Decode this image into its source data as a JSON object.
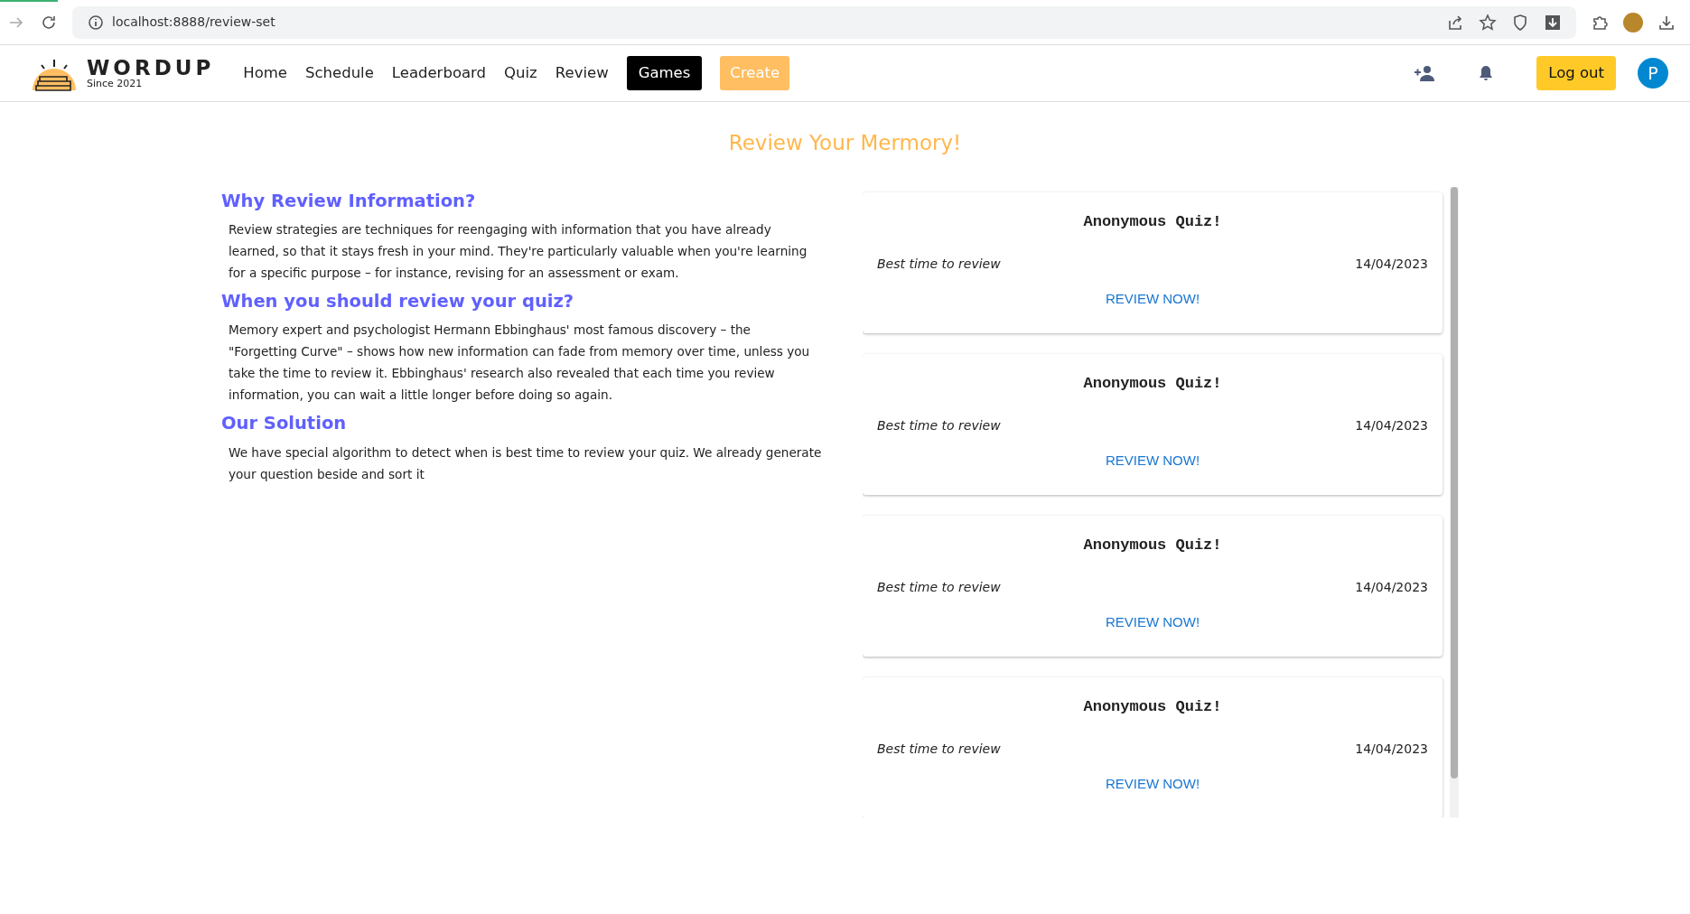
{
  "browser": {
    "url": "localhost:8888/review-set"
  },
  "brand": {
    "name": "WORDUP",
    "tagline": "Since 2021"
  },
  "nav": [
    {
      "label": "Home",
      "kind": "link"
    },
    {
      "label": "Schedule",
      "kind": "link"
    },
    {
      "label": "Leaderboard",
      "kind": "link"
    },
    {
      "label": "Quiz",
      "kind": "link"
    },
    {
      "label": "Review",
      "kind": "link"
    },
    {
      "label": "Games",
      "kind": "dark"
    },
    {
      "label": "Create",
      "kind": "accent"
    }
  ],
  "logout": "Log out",
  "avatar": "P",
  "page_title": "Review Your Mermory!",
  "sections": [
    {
      "heading": "Why Review Information?",
      "text": "Review strategies are techniques for reengaging with information that you have already learned, so that it stays fresh in your mind. They're particularly valuable when you're learning for a specific purpose – for instance, revising for an assessment or exam."
    },
    {
      "heading": "When you should review your quiz?",
      "text": "Memory expert and psychologist Hermann Ebbinghaus' most famous discovery – the \"Forgetting Curve\" – shows how new information can fade from memory over time, unless you take the time to review it. Ebbinghaus' research also revealed that each time you review information, you can wait a little longer before doing so again."
    },
    {
      "heading": "Our Solution",
      "text": "We have special algorithm to detect when is best time to review your quiz. We already generate your question beside and sort it"
    }
  ],
  "cards": [
    {
      "title": "Anonymous Quiz!",
      "label": "Best time to review",
      "date": "14/04/2023",
      "action": "REVIEW NOW!"
    },
    {
      "title": "Anonymous Quiz!",
      "label": "Best time to review",
      "date": "14/04/2023",
      "action": "REVIEW NOW!"
    },
    {
      "title": "Anonymous Quiz!",
      "label": "Best time to review",
      "date": "14/04/2023",
      "action": "REVIEW NOW!"
    },
    {
      "title": "Anonymous Quiz!",
      "label": "Best time to review",
      "date": "14/04/2023",
      "action": "REVIEW NOW!"
    }
  ]
}
